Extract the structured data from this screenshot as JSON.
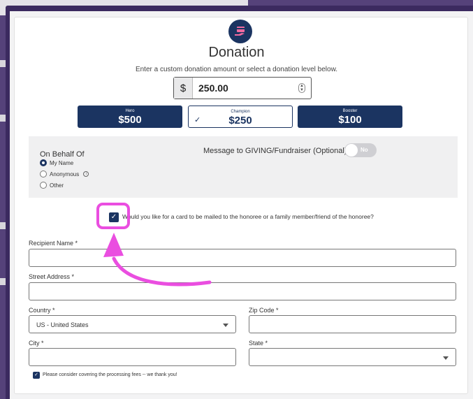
{
  "colors": {
    "navy": "#1b3461",
    "highlight_pink": "#ea4ee0",
    "frame_purple": "#3b2a5f"
  },
  "logo": {
    "icon": "card-hand-icon"
  },
  "form": {
    "title": "Donation",
    "subtitle": "Enter a custom donation amount or select a donation level below.",
    "currency_symbol": "$",
    "amount_value": "250.00"
  },
  "levels": [
    {
      "name": "Hero",
      "amount": "$500",
      "selected": false
    },
    {
      "name": "Champion",
      "amount": "$250",
      "selected": true
    },
    {
      "name": "Booster",
      "amount": "$100",
      "selected": false
    }
  ],
  "behalf": {
    "title": "On Behalf Of",
    "options": [
      "My Name",
      "Anonymous",
      "Other"
    ],
    "selected": "My Name"
  },
  "message": {
    "label": "Message to GIVING/Fundraiser (Optional)",
    "toggle_label": "No"
  },
  "card_question": "Would you like for a card to be mailed to the honoree or a family member/friend of the honoree?",
  "fields": {
    "recipient_name_label": "Recipient Name *",
    "street_address_label": "Street Address *",
    "country_label": "Country *",
    "country_value": "US - United States",
    "zip_label": "Zip Code *",
    "city_label": "City *",
    "state_label": "State *"
  },
  "fees_label": "Please consider covering the processing fees -- we thank you!"
}
